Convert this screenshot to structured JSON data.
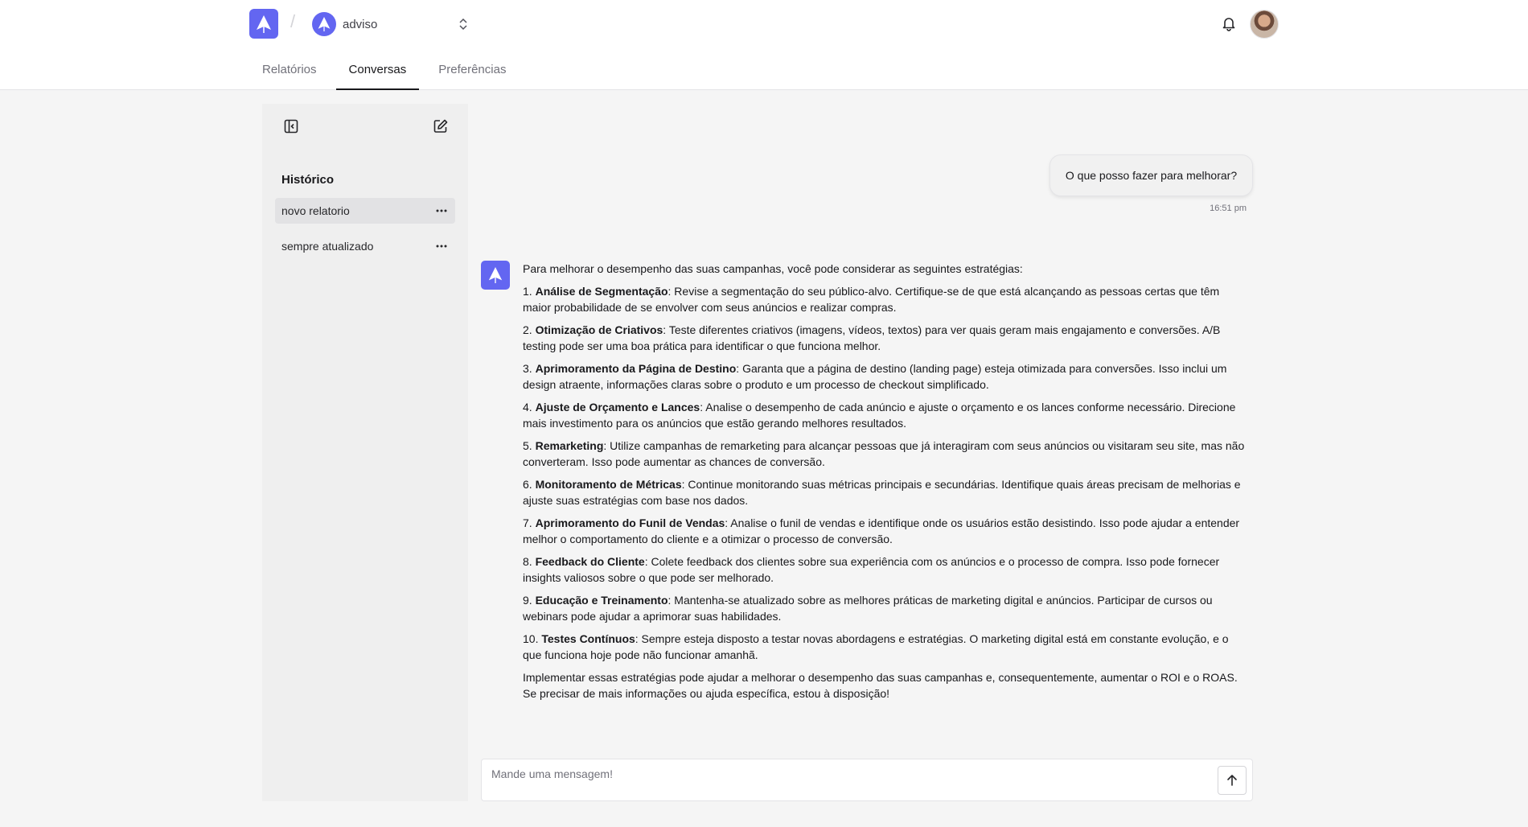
{
  "header": {
    "org_name": "adviso",
    "tabs": [
      {
        "label": "Relatórios",
        "active": false
      },
      {
        "label": "Conversas",
        "active": true
      },
      {
        "label": "Preferências",
        "active": false
      }
    ]
  },
  "sidebar": {
    "title": "Histórico",
    "items": [
      {
        "label": "novo relatorio",
        "active": true
      },
      {
        "label": "sempre atualizado",
        "active": false
      }
    ]
  },
  "chat": {
    "user_message": "O que posso fazer para melhorar?",
    "user_time": "16:51 pm",
    "bot": {
      "intro": "Para melhorar o desempenho das suas campanhas, você pode considerar as seguintes estratégias:",
      "items": [
        {
          "num": "1.",
          "title": "Análise de Segmentação",
          "text": ": Revise a segmentação do seu público-alvo. Certifique-se de que está alcançando as pessoas certas que têm maior probabilidade de se envolver com seus anúncios e realizar compras."
        },
        {
          "num": "2.",
          "title": "Otimização de Criativos",
          "text": ": Teste diferentes criativos (imagens, vídeos, textos) para ver quais geram mais engajamento e conversões. A/B testing pode ser uma boa prática para identificar o que funciona melhor."
        },
        {
          "num": "3.",
          "title": "Aprimoramento da Página de Destino",
          "text": ": Garanta que a página de destino (landing page) esteja otimizada para conversões. Isso inclui um design atraente, informações claras sobre o produto e um processo de checkout simplificado."
        },
        {
          "num": "4.",
          "title": "Ajuste de Orçamento e Lances",
          "text": ": Analise o desempenho de cada anúncio e ajuste o orçamento e os lances conforme necessário. Direcione mais investimento para os anúncios que estão gerando melhores resultados."
        },
        {
          "num": "5.",
          "title": "Remarketing",
          "text": ": Utilize campanhas de remarketing para alcançar pessoas que já interagiram com seus anúncios ou visitaram seu site, mas não converteram. Isso pode aumentar as chances de conversão."
        },
        {
          "num": "6.",
          "title": "Monitoramento de Métricas",
          "text": ": Continue monitorando suas métricas principais e secundárias. Identifique quais áreas precisam de melhorias e ajuste suas estratégias com base nos dados."
        },
        {
          "num": "7.",
          "title": "Aprimoramento do Funil de Vendas",
          "text": ": Analise o funil de vendas e identifique onde os usuários estão desistindo. Isso pode ajudar a entender melhor o comportamento do cliente e a otimizar o processo de conversão."
        },
        {
          "num": "8.",
          "title": "Feedback do Cliente",
          "text": ": Colete feedback dos clientes sobre sua experiência com os anúncios e o processo de compra. Isso pode fornecer insights valiosos sobre o que pode ser melhorado."
        },
        {
          "num": "9.",
          "title": "Educação e Treinamento",
          "text": ": Mantenha-se atualizado sobre as melhores práticas de marketing digital e anúncios. Participar de cursos ou webinars pode ajudar a aprimorar suas habilidades."
        },
        {
          "num": "10.",
          "title": "Testes Contínuos",
          "text": ": Sempre esteja disposto a testar novas abordagens e estratégias. O marketing digital está em constante evolução, e o que funciona hoje pode não funcionar amanhã."
        }
      ],
      "outro": "Implementar essas estratégias pode ajudar a melhorar o desempenho das suas campanhas e, consequentemente, aumentar o ROI e o ROAS. Se precisar de mais informações ou ajuda específica, estou à disposição!"
    }
  },
  "composer": {
    "placeholder": "Mande uma mensagem!"
  },
  "icons": {
    "logo": "rocket-logo-icon",
    "org_switch": "chevron-up-down-icon",
    "notifications": "bell-icon",
    "collapse_sidebar": "panel-left-close-icon",
    "new_chat": "edit-square-icon",
    "item_menu": "ellipsis-icon",
    "send": "arrow-up-icon"
  },
  "colors": {
    "brand": "#6366f1",
    "background": "#f5f5f5",
    "sidebar": "#efefef",
    "active_item": "#e2e2e4"
  }
}
